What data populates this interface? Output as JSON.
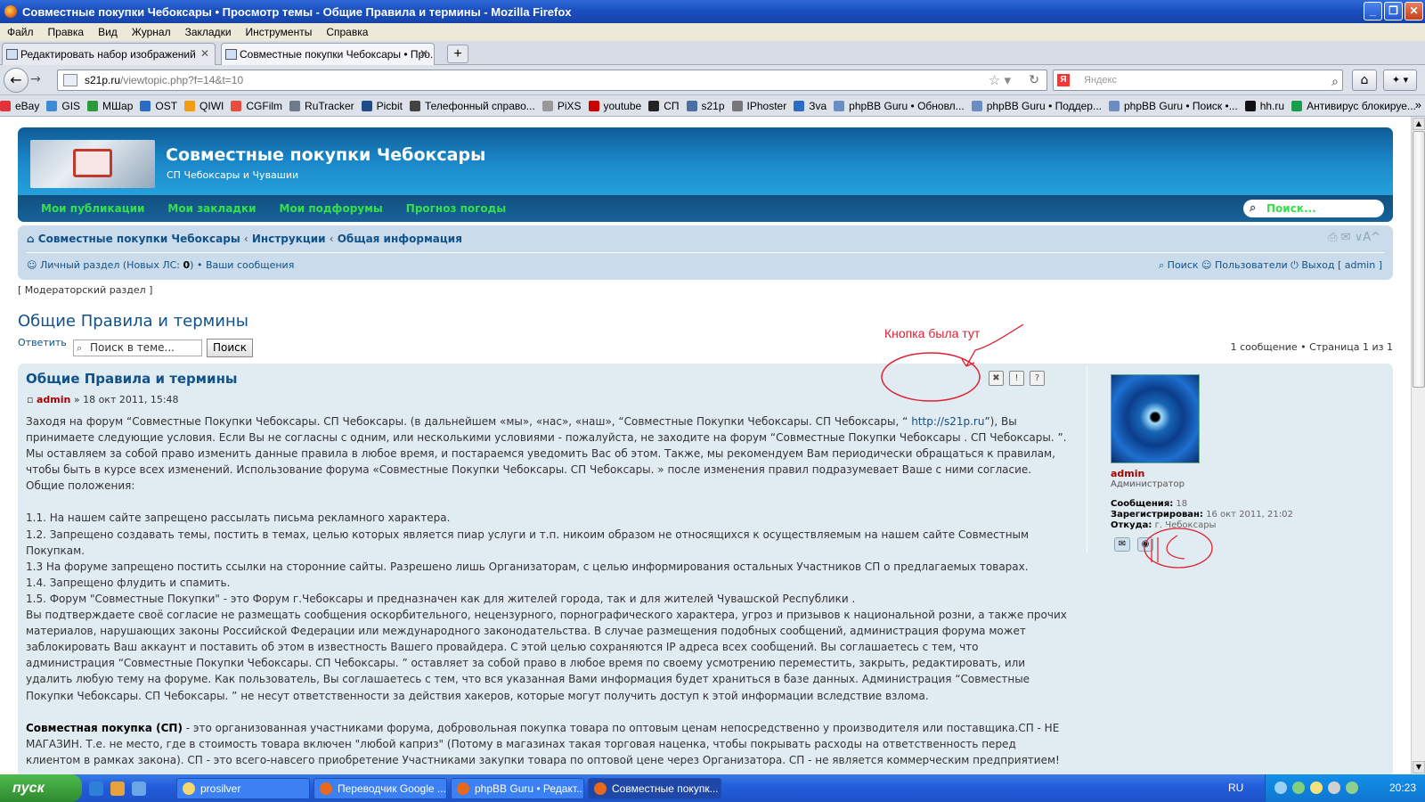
{
  "window": {
    "title": "Совместные покупки Чебоксары • Просмотр темы - Общие Правила и термины - Mozilla Firefox"
  },
  "menu": [
    "Файл",
    "Правка",
    "Вид",
    "Журнал",
    "Закладки",
    "Инструменты",
    "Справка"
  ],
  "tabs": [
    {
      "label": "Редактировать набор изображений"
    },
    {
      "label": "Совместные покупки Чебоксары • Про..."
    }
  ],
  "address": {
    "host": "s21p.ru",
    "path": "/viewtopic.php?f=14&t=10"
  },
  "search_engine": {
    "placeholder": "Яндекс"
  },
  "bookmarks": [
    {
      "label": "eBay",
      "color": "#e53238"
    },
    {
      "label": "GIS",
      "color": "#3d8bd4"
    },
    {
      "label": "МШар",
      "color": "#2a9a3a"
    },
    {
      "label": "OST",
      "color": "#2b6cc4"
    },
    {
      "label": "QIWI",
      "color": "#f39c12"
    },
    {
      "label": "CGFilm",
      "color": "#e74c3c"
    },
    {
      "label": "RuTracker",
      "color": "#6d7a8a"
    },
    {
      "label": "Picbit",
      "color": "#1f4d8a"
    },
    {
      "label": "Телефонный справо...",
      "color": "#444444"
    },
    {
      "label": "PiXS",
      "color": "#999999"
    },
    {
      "label": "youtube",
      "color": "#cc0000"
    },
    {
      "label": "СП",
      "color": "#222222"
    },
    {
      "label": "s21p",
      "color": "#4a6fa5"
    },
    {
      "label": "IPhoster",
      "color": "#777777"
    },
    {
      "label": "Зvа",
      "color": "#2b6cc4"
    },
    {
      "label": "phpBB Guru • Обновл...",
      "color": "#6b8ec2"
    },
    {
      "label": "phpBB Guru • Поддер...",
      "color": "#6b8ec2"
    },
    {
      "label": "phpBB Guru • Поиск •...",
      "color": "#6b8ec2"
    },
    {
      "label": "hh.ru",
      "color": "#111111"
    },
    {
      "label": "Антивирус блокируе...",
      "color": "#1a9e4a"
    }
  ],
  "forum": {
    "site_title": "Совместные покупки Чебоксары",
    "site_desc": "СП Чебоксары и Чувашии",
    "nav": [
      "Мои публикации",
      "Мои закладки",
      "Мои подфорумы",
      "Прогноз погоды"
    ],
    "search_placeholder": "Поиск...",
    "breadcrumbs": [
      "Совместные покупки Чебоксары",
      "Инструкции",
      "Общая информация"
    ],
    "ucp_text": "Личный раздел (Новых ЛС: ",
    "ucp_count": "0",
    "ucp_tail": ") • Ваши сообщения",
    "right_links": {
      "search": "Поиск",
      "members": "Пользователи",
      "logout": "Выход [ admin ]"
    },
    "mod_link": "[ Модераторский раздел ]",
    "topic_title": "Общие Правила и термины",
    "reply": "Ответить",
    "topic_search_placeholder": "Поиск в теме...",
    "topic_search_btn": "Поиск",
    "pagination": "1 сообщение • Страница 1 из 1",
    "annotation": "Кнопка была тут"
  },
  "post": {
    "title": "Общие Правила и термины",
    "author": "admin",
    "date": "» 18 окт 2011, 15:48",
    "paragraphs": [
      "Заходя на форум “Совместные Покупки Чебоксары. СП Чебоксары. (в дальнейшем «мы», «нас», «наш», “Совместные Покупки Чебоксары. СП Чебоксары, “ ",
      "http://s21p.ru",
      "”), Вы принимаете следующие условия. Если Вы не согласны с одним, или несколькими условиями - пожалуйста, не заходите на форум “Совместные Покупки Чебоксары . СП Чебоксары. ”. Мы оставляем за собой право изменить данные правила в любое время, и постараемся уведомить Вас об этом. Также, мы рекомендуем Вам периодически обращаться к правилам, чтобы быть в курсе всех изменений. Использование форума «Совместные Покупки Чебоксары. СП Чебоксары. » после изменения правил подразумевает Ваше с ними согласие.",
      "Общие положения:",
      "1.1. На нашем сайте запрещено рассылать письма рекламного характера.",
      "1.2. Запрещено создавать темы, постить в темах, целью которых является пиар услуги и т.п. никоим образом не относящихся к осуществляемым на нашем сайте Совместным Покупкам.",
      "1.3 На форуме запрещено постить ссылки на сторонние сайты. Разрешено лишь Организаторам, с целью информирования остальных Участников СП о предлагаемых товарах.",
      "1.4. Запрещено флудить и спамить.",
      "1.5. Форум \"Совместные Покупки\" - это Форум г.Чебоксары и предназначен как для жителей города, так и для жителей Чувашской Республики .",
      "Вы подтверждаете своё согласие не размещать сообщения оскорбительного, нецензурного, порнографического характера, угроз и призывов к национальной розни, а также прочих материалов, нарушающих законы Российской Федерации или международного законодательства. В случае размещения подобных сообщений, администрация форума может заблокировать Ваш аккаунт и поставить об этом в известность Вашего провайдера. С этой целью сохраняются IP адреса всех сообщений. Вы соглашаетесь с тем, что администрация “Совместные Покупки Чебоксары. СП Чебоксары. ” оставляет за собой право в любое время по своему усмотрению переместить, закрыть, редактировать, или удалить любую тему на форуме. Как пользователь, Вы соглашаетесь с тем, что вся указанная Вами информация будет храниться в базе данных. Администрация “Совместные Покупки Чебоксары. СП Чебоксары. ” не несут ответственности за действия хакеров, которые могут получить доступ к этой информации вследствие взлома.",
      "Совместная покупка (СП)",
      " - это организованная участниками форума, добровольная покупка товара по оптовым ценам непосредственно у производителя или поставщика.СП - НЕ МАГАЗИН. Т.е. не место, где в стоимость товара включен \"любой каприз\" (Потому в магазинах такая торговая наценка, чтобы покрывать расходы на ответственность перед клиентом в рамках закона). СП - это всего-навсего приобретение Участниками закупки товара по оптовой цене через Организатора. СП - не является коммерческим предприятием!"
    ]
  },
  "profile": {
    "name": "admin",
    "rank": "Администратор",
    "posts_label": "Сообщения:",
    "posts": "18",
    "reg_label": "Зарегистрирован:",
    "reg": "16 окт 2011, 21:02",
    "from_label": "Откуда:",
    "from": "г. Чебоксары"
  },
  "taskbar": {
    "start": "пуск",
    "buttons": [
      {
        "label": "prosilver",
        "color": "#f5d76e"
      },
      {
        "label": "Переводчик Google ...",
        "color": "#e8691b"
      },
      {
        "label": "phpBB Guru • Редакт...",
        "color": "#e8691b"
      },
      {
        "label": "Совместные покупк...",
        "color": "#e8691b"
      }
    ],
    "lang": "RU",
    "clock": "20:23"
  }
}
